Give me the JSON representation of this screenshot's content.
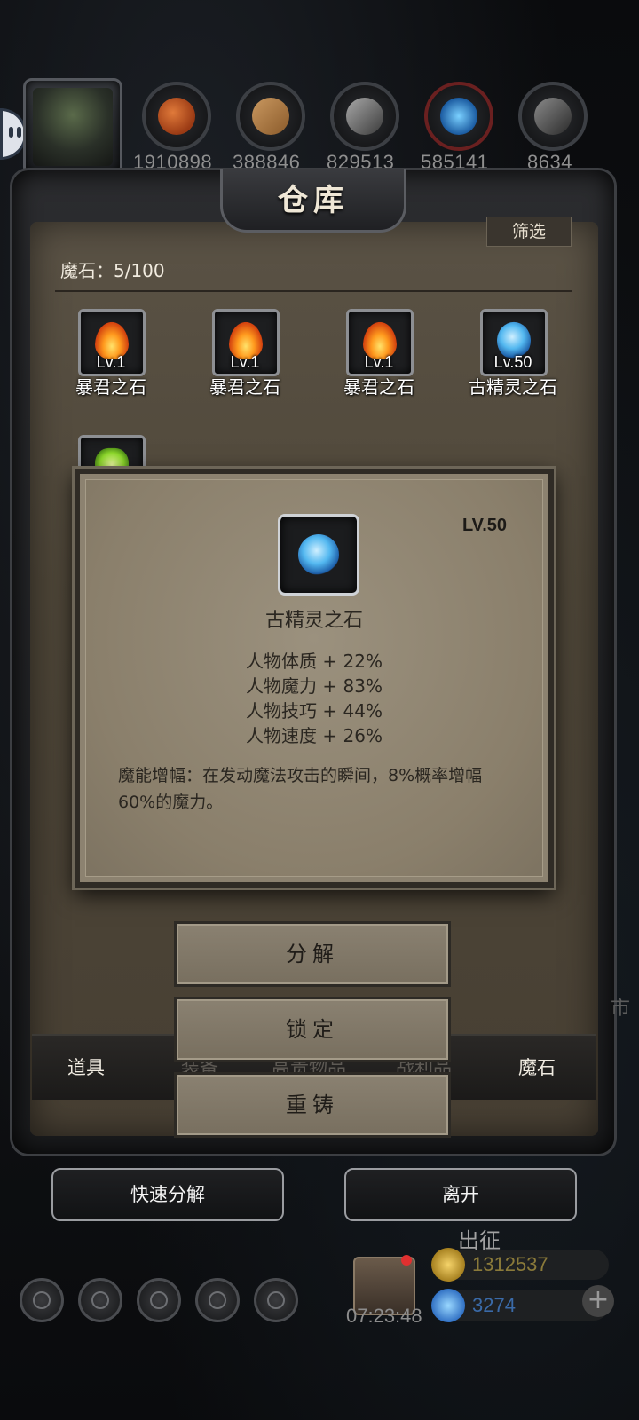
{
  "resources": {
    "values": [
      "1910898",
      "388846",
      "829513",
      "585141",
      "8634"
    ],
    "icons": [
      "meat-icon",
      "wood-icon",
      "iron-icon",
      "crystal-icon",
      "stone-icon"
    ]
  },
  "warehouse": {
    "title": "仓库",
    "filter_label": "筛选",
    "count_label": "魔石：5/100"
  },
  "items": [
    {
      "level": "Lv.1",
      "name": "暴君之石",
      "icon": "fire-stone-icon"
    },
    {
      "level": "Lv.1",
      "name": "暴君之石",
      "icon": "fire-stone-icon"
    },
    {
      "level": "Lv.1",
      "name": "暴君之石",
      "icon": "fire-stone-icon"
    },
    {
      "level": "Lv.50",
      "name": "古精灵之石",
      "icon": "elf-stone-icon"
    },
    {
      "level": "",
      "name": "",
      "icon": "green-stone-icon"
    }
  ],
  "tabs": {
    "left": "道具",
    "hidden": [
      "装备",
      "高贵物品",
      "战利品"
    ],
    "right": "魔石"
  },
  "popup": {
    "level": "LV.50",
    "name": "古精灵之石",
    "stats": [
      "人物体质 + 22%",
      "人物魔力 + 83%",
      "人物技巧 + 44%",
      "人物速度 + 26%"
    ],
    "description": "魔能增幅：在发动魔法攻击的瞬间，8%概率增幅60%的魔力。"
  },
  "actions": {
    "decompose": "分解",
    "lock": "锁定",
    "reforge": "重铸"
  },
  "bottom": {
    "quick_decompose": "快速分解",
    "leave": "离开"
  },
  "hud": {
    "expedition": "出征",
    "timer": "07:23:48",
    "gold": "1312537",
    "gems": "3274",
    "right_edge_char": "市"
  },
  "colors": {
    "gold_text": "#8a7a3a",
    "gem_text": "#3a6aa8"
  }
}
